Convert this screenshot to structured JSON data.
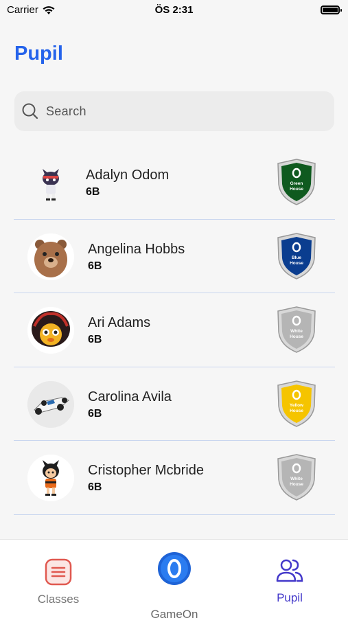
{
  "status_bar": {
    "carrier": "Carrier",
    "time": "ÖS 2:31"
  },
  "page": {
    "title": "Pupil"
  },
  "search": {
    "placeholder": "Search"
  },
  "pupils": [
    {
      "name": "Adalyn Odom",
      "class": "6B",
      "house": "Green House",
      "house_color": "#0f5a1f",
      "avatar": "cat-character-icon"
    },
    {
      "name": "Angelina Hobbs",
      "class": "6B",
      "house": "Blue House",
      "house_color": "#0a3d8f",
      "avatar": "bear-icon"
    },
    {
      "name": "Ari Adams",
      "class": "6B",
      "house": "White House",
      "house_color": "#b5b5b5",
      "avatar": "red-hair-character-icon"
    },
    {
      "name": "Carolina Avila",
      "class": "6B",
      "house": "Yellow House",
      "house_color": "#f5c400",
      "avatar": "race-car-icon"
    },
    {
      "name": "Cristopher Mcbride",
      "class": "6B",
      "house": "White House",
      "house_color": "#b5b5b5",
      "avatar": "cat-girl-character-icon"
    }
  ],
  "tab_bar": {
    "classes_label": "Classes",
    "gameon_label": "GameOn",
    "pupil_label": "Pupil",
    "active_tab": "Pupil"
  },
  "colors": {
    "accent": "#2563eb",
    "active_tab": "#4338ca",
    "classes_icon": "#e0584f"
  }
}
